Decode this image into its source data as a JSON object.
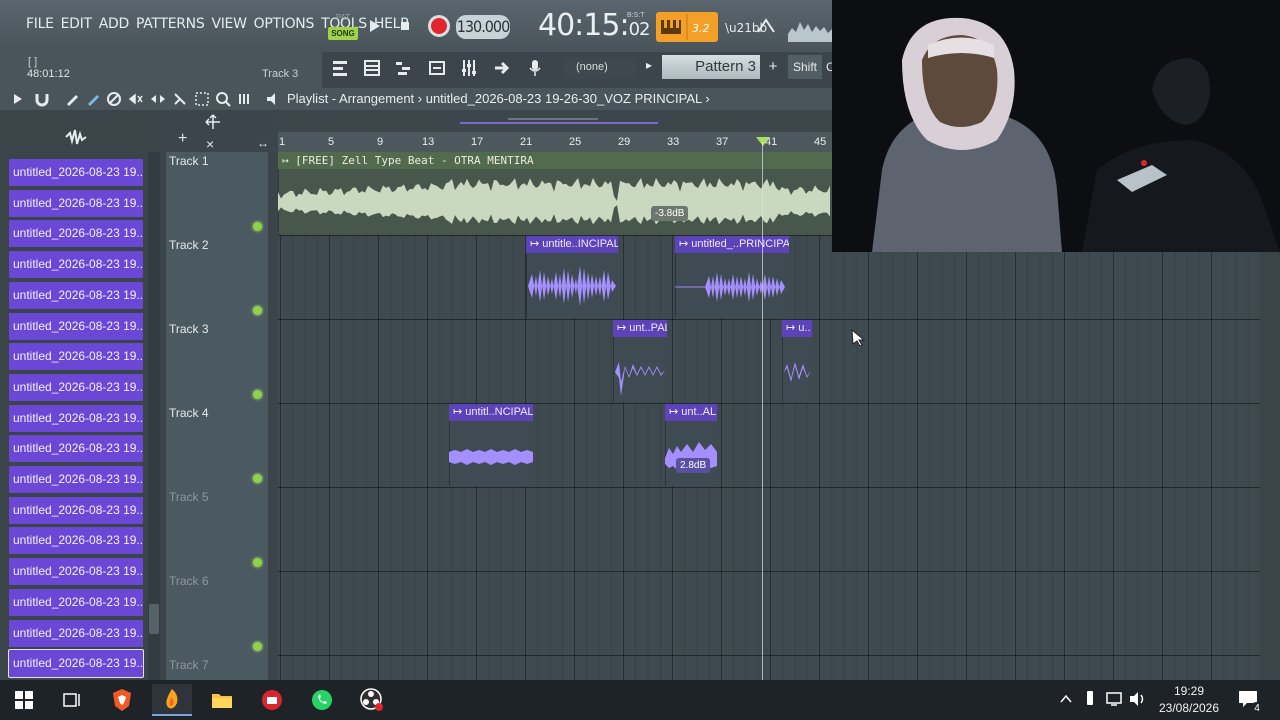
{
  "menu": [
    "FILE",
    "EDIT",
    "ADD",
    "PATTERNS",
    "VIEW",
    "OPTIONS",
    "TOOLS",
    "HELP"
  ],
  "hint": {
    "bracket": "[ ]",
    "time": "48:01:12",
    "track": "Track 3"
  },
  "transport": {
    "pat": "PAT",
    "song": "SONG",
    "tempo": "130.000",
    "time_main": "40:15",
    "time_sub": "02",
    "bst": "B:S:T"
  },
  "toolbar2": {
    "channel": "(none)",
    "pattern": "Pattern 3",
    "add": "+",
    "shift": "Shift",
    "c": "C"
  },
  "playlist": {
    "title": "Playlist - Arrangement › untitled_2026-08-23 19-26-30_VOZ PRINCIPAL ›"
  },
  "ruler": [
    "1",
    "5",
    "9",
    "13",
    "17",
    "21",
    "25",
    "29",
    "33",
    "37",
    "41",
    "45"
  ],
  "browser": {
    "items": [
      "untitled_2026-08-23 19...",
      "untitled_2026-08-23 19...",
      "untitled_2026-08-23 19...",
      "untitled_2026-08-23 19...",
      "untitled_2026-08-23 19...",
      "untitled_2026-08-23 19...",
      "untitled_2026-08-23 19...",
      "untitled_2026-08-23 19...",
      "untitled_2026-08-23 19...",
      "untitled_2026-08-23 19...",
      "untitled_2026-08-23 19...",
      "untitled_2026-08-23 19...",
      "untitled_2026-08-23 19...",
      "untitled_2026-08-23 19...",
      "untitled_2026-08-23 19...",
      "untitled_2026-08-23 19...",
      "untitled_2026-08-23 19..."
    ]
  },
  "tracks": [
    "Track 1",
    "Track 2",
    "Track 3",
    "Track 4",
    "Track 5",
    "Track 6",
    "Track 7"
  ],
  "clips": {
    "beat": "↦ [FREE] Zell Type Beat - OTRA MENTIRA",
    "t2a": "↦ untitle..INCIPAL",
    "t2b": "↦ untitled_..PRINCIPAL",
    "t3a": "↦ unt..PAL",
    "t3b": "↦ u..",
    "t4a": "↦ untitl..NCIPAL",
    "t4b": "↦ unt..AL",
    "db1": "-3.8dB",
    "db2": "2.8dB"
  },
  "clock": {
    "time": "19:29",
    "date": "23/08/2026"
  },
  "notifications": "4",
  "colors": {
    "accent": "#f4a028",
    "clip_purple": "#6b47d6",
    "beat_clip": "#c8d9c0",
    "led_green": "#8ed24a"
  }
}
